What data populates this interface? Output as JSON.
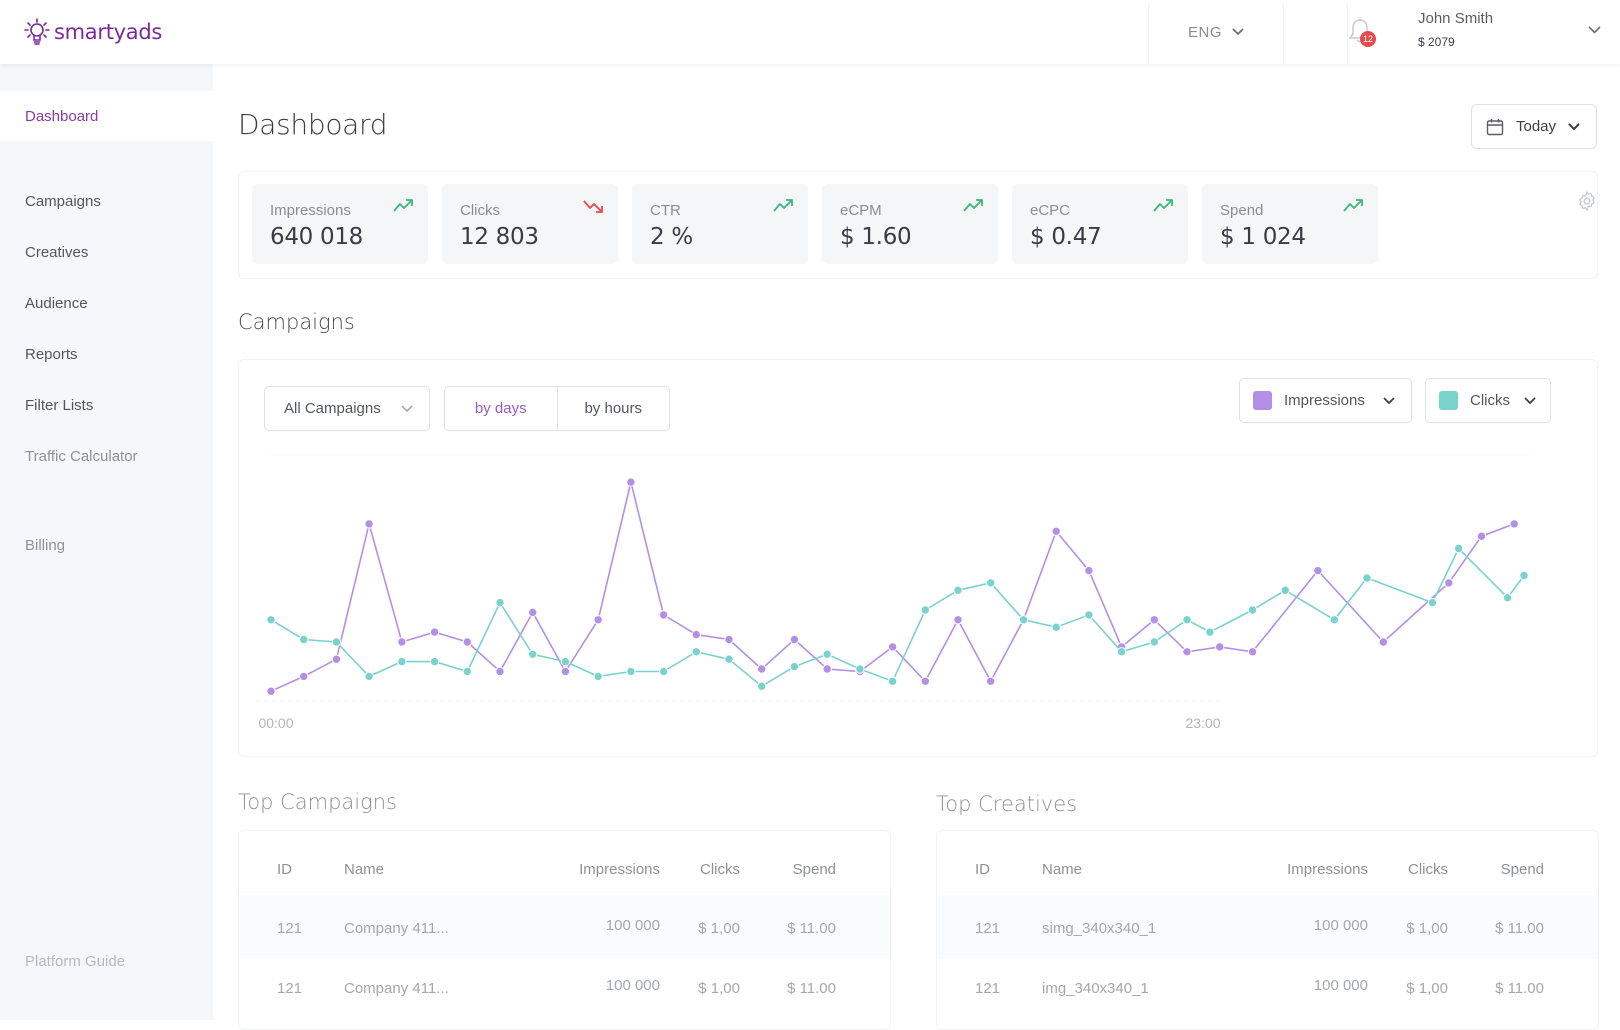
{
  "app": {
    "brand": "smartyads",
    "brand_color": "#7a2a9a"
  },
  "topbar": {
    "language": "ENG",
    "notifications_count": "12",
    "user_name": "John Smith",
    "user_balance": "$ 2079"
  },
  "sidebar": {
    "items": [
      {
        "label": "Dashboard",
        "active": true
      },
      {
        "label": "Campaigns"
      },
      {
        "label": "Creatives"
      },
      {
        "label": "Audience"
      },
      {
        "label": "Reports"
      },
      {
        "label": "Filter Lists"
      },
      {
        "label": "Traffic Calculator"
      },
      {
        "label": "Billing"
      }
    ],
    "footer_link": "Platform Guide"
  },
  "header": {
    "title": "Dashboard",
    "date_range": "Today"
  },
  "kpis": [
    {
      "label": "Impressions",
      "value": "640 018",
      "trend": "up"
    },
    {
      "label": "Clicks",
      "value": "12 803",
      "trend": "down"
    },
    {
      "label": "CTR",
      "value": "2 %",
      "trend": "up"
    },
    {
      "label": "eCPM",
      "value": "$ 1.60",
      "trend": "up"
    },
    {
      "label": "eCPC",
      "value": "$ 0.47",
      "trend": "up"
    },
    {
      "label": "Spend",
      "value": "$ 1 024",
      "trend": "up"
    }
  ],
  "colors": {
    "up": "#3cb878",
    "down": "#e5484d",
    "impressions": "#b48fe6",
    "clicks": "#79d2cb",
    "accent": "#8b3aa8"
  },
  "campaigns_section": {
    "title": "Campaigns",
    "campaign_filter": "All Campaigns",
    "granularity": [
      {
        "label": "by days",
        "active": true
      },
      {
        "label": "by hours",
        "active": false
      }
    ],
    "metric_left": "Impressions",
    "metric_right": "Clicks"
  },
  "chart_data": {
    "type": "line",
    "title": "",
    "xlabel": "",
    "ylabel": "",
    "x_tick_labels": [
      "00:00",
      "23:00"
    ],
    "ylim": [
      0,
      100
    ],
    "grid": false,
    "legend": "top-right (metric selectors)",
    "series": [
      {
        "name": "Impressions",
        "color": "#b48fe6",
        "points": [
          [
            0,
            4
          ],
          [
            1,
            10
          ],
          [
            2,
            17
          ],
          [
            3,
            72
          ],
          [
            4,
            24
          ],
          [
            5,
            28
          ],
          [
            6,
            24
          ],
          [
            7,
            12
          ],
          [
            8,
            36
          ],
          [
            9,
            12
          ],
          [
            10,
            33
          ],
          [
            11,
            89
          ],
          [
            12,
            35
          ],
          [
            13,
            27
          ],
          [
            14,
            25
          ],
          [
            15,
            13
          ],
          [
            16,
            25
          ],
          [
            17,
            13
          ],
          [
            18,
            12
          ],
          [
            19,
            22
          ],
          [
            20,
            8
          ],
          [
            21,
            33
          ],
          [
            22,
            8
          ],
          [
            23,
            33
          ],
          [
            24,
            69
          ],
          [
            25,
            53
          ],
          [
            26,
            22
          ],
          [
            27,
            33
          ],
          [
            28,
            20
          ],
          [
            29,
            22
          ],
          [
            30,
            20
          ],
          [
            32,
            53
          ],
          [
            34,
            24
          ],
          [
            36,
            48
          ],
          [
            37,
            67
          ],
          [
            38,
            72
          ]
        ]
      },
      {
        "name": "Clicks",
        "color": "#79d2cb",
        "points": [
          [
            0,
            33
          ],
          [
            1,
            25
          ],
          [
            2,
            24
          ],
          [
            3,
            10
          ],
          [
            4,
            16
          ],
          [
            5,
            16
          ],
          [
            6,
            12
          ],
          [
            7,
            40
          ],
          [
            8,
            19
          ],
          [
            9,
            16
          ],
          [
            10,
            10
          ],
          [
            11,
            12
          ],
          [
            12,
            12
          ],
          [
            13,
            20
          ],
          [
            14,
            17
          ],
          [
            15,
            6
          ],
          [
            16,
            14
          ],
          [
            17,
            19
          ],
          [
            18,
            13
          ],
          [
            19,
            8
          ],
          [
            20,
            37
          ],
          [
            21,
            45
          ],
          [
            22,
            48
          ],
          [
            23,
            33
          ],
          [
            24,
            30
          ],
          [
            25,
            35
          ],
          [
            26,
            20
          ],
          [
            27,
            24
          ],
          [
            28,
            33
          ],
          [
            28.7,
            28
          ],
          [
            30,
            37
          ],
          [
            31,
            45
          ],
          [
            32.5,
            33
          ],
          [
            33.5,
            50
          ],
          [
            35.5,
            40
          ],
          [
            36.3,
            62
          ],
          [
            37.8,
            42
          ],
          [
            38.3,
            51
          ]
        ]
      }
    ]
  },
  "top_campaigns": {
    "title": "Top Campaigns",
    "columns": [
      "ID",
      "Name",
      "Impressions",
      "Clicks",
      "Spend"
    ],
    "rows": [
      [
        "121",
        "Company 411...",
        "100 000",
        "$ 1,00",
        "$ 11.00"
      ],
      [
        "121",
        "Company 411...",
        "100 000",
        "$ 1,00",
        "$ 11.00"
      ]
    ]
  },
  "top_creatives": {
    "title": "Top Creatives",
    "columns": [
      "ID",
      "Name",
      "Impressions",
      "Clicks",
      "Spend"
    ],
    "rows": [
      [
        "121",
        "simg_340x340_1",
        "100 000",
        "$ 1,00",
        "$ 11.00"
      ],
      [
        "121",
        "img_340x340_1",
        "100 000",
        "$ 1,00",
        "$ 11.00"
      ]
    ]
  }
}
